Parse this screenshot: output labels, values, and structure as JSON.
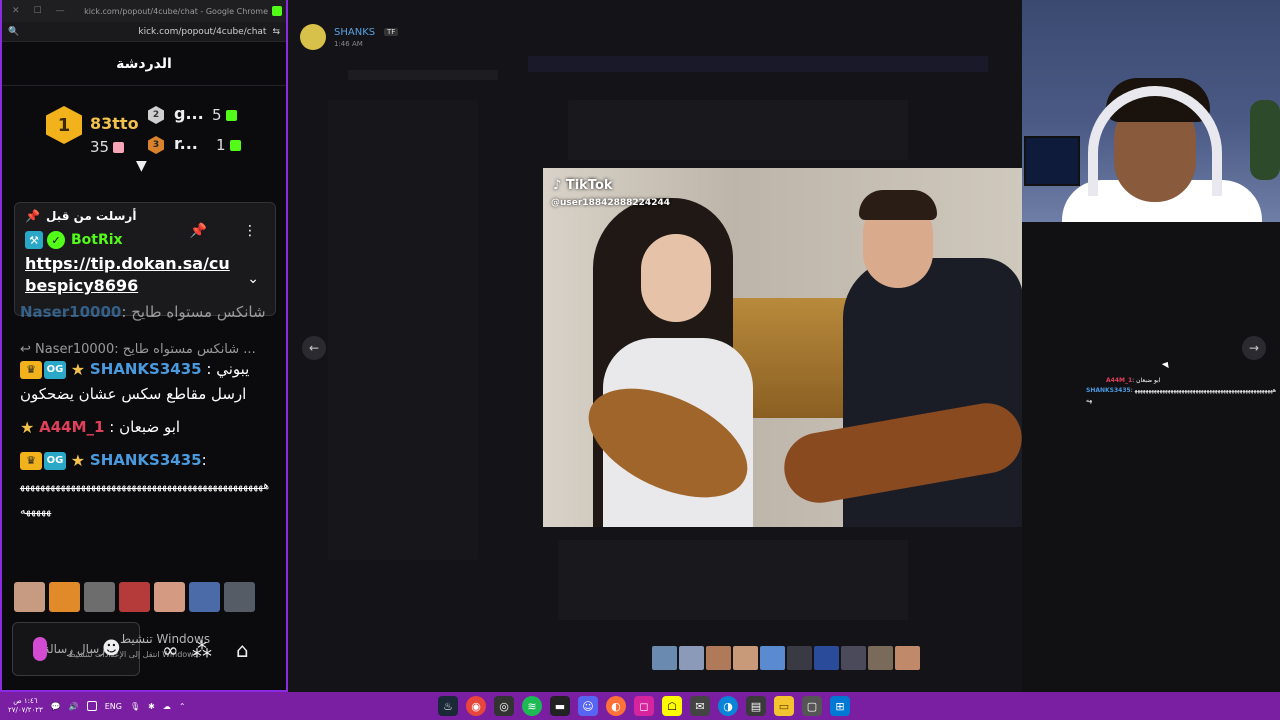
{
  "chrome": {
    "title": "kick.com/popout/4cube/chat - Google Chrome",
    "url": "kick.com/popout/4cube/chat"
  },
  "chat": {
    "header": "الدردشة",
    "leaderboard": [
      {
        "rank": "1",
        "name": "83tto",
        "count": "35",
        "accent": "#f2b21c"
      },
      {
        "rank": "2",
        "name": "g...",
        "count": "5",
        "accent": "#cfcfcf"
      },
      {
        "rank": "3",
        "name": "r...",
        "count": "1",
        "accent": "#d9822b"
      }
    ],
    "pinned": {
      "label": "أرسلت من قبل",
      "bot_name": "BotRix",
      "link": "https://tip.dokan.sa/cubespicy8696"
    },
    "messages": [
      {
        "user": "Naser10000",
        "text": ": شانكس مستواه طايح",
        "user_color": "#4a9ae0"
      },
      {
        "reply_preview": "Naser10000: شانكس مستواه طايح ..."
      },
      {
        "user": "SHANKS3435",
        "text": ": يبوني ارسل مقاطع سكس عشان يضحكون",
        "user_color": "#4a9ae0"
      },
      {
        "user": "A44M_1",
        "text": ": ابو ضبعان",
        "user_color": "#e0405a"
      },
      {
        "user": "SHANKS3435",
        "text": ":",
        "long": "ههههههههههههههههههههههههههههههههههههههههههههههههههههههه",
        "user_color": "#4a9ae0"
      }
    ],
    "input_placeholder": "ارسال رسالة",
    "activate_windows": "تنشيط Windows",
    "activate_windows_sub": "انتقل إلى الإعدادات لتنشيط Windows."
  },
  "discord": {
    "poster_name": "SHANKS",
    "poster_tag": "TF",
    "poster_time": "1:46 AM",
    "tiktok_label": "TikTok",
    "tiktok_user": "@user18842888224244"
  },
  "overlay": {
    "user1": "A44M_1",
    "user1_text": ": ابو ضبعان",
    "user2": "SHANKS3435",
    "user2_text": ": ههههههههههههههههههههههههههههههههههههههههههههههههههههه"
  },
  "taskbar": {
    "time": "١:٤٦ ص",
    "date": "٢٧/٠٧/٢٠٢٣",
    "lang": "ENG"
  },
  "colors": {
    "kick_green": "#53fc18",
    "taskbar": "#7a1fa2",
    "window_border": "#8a2be2"
  }
}
